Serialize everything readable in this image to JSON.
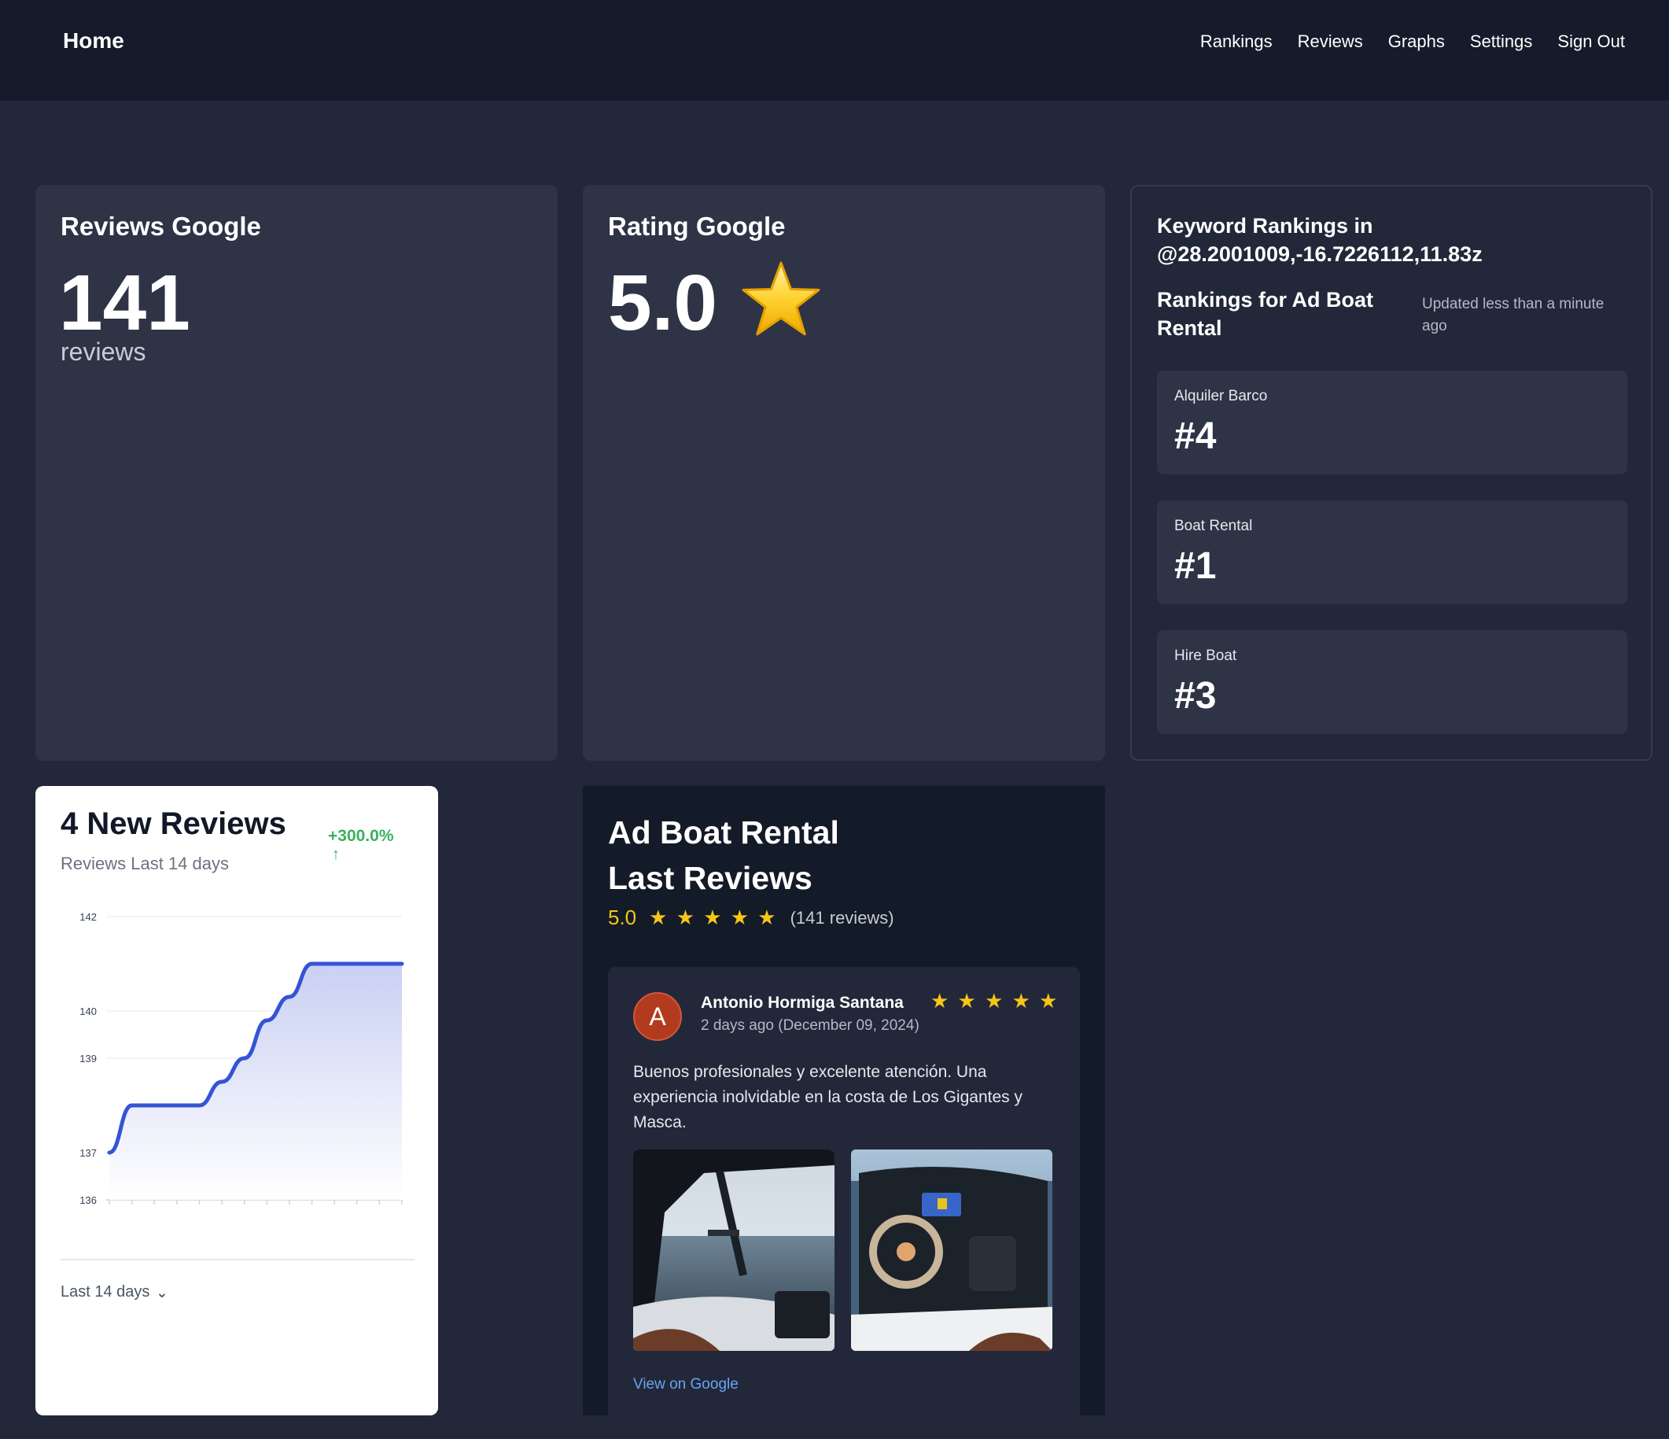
{
  "header": {
    "brand": "Home",
    "nav": [
      "Rankings",
      "Reviews",
      "Graphs",
      "Settings",
      "Sign Out"
    ]
  },
  "reviews_card": {
    "title": "Reviews Google",
    "count": "141",
    "unit": "reviews"
  },
  "rating_card": {
    "title": "Rating Google",
    "value": "5.0",
    "star_icon": "⭐"
  },
  "keywords_card": {
    "title": "Keyword Rankings in @28.2001009,-16.7226112,11.83z",
    "subtitle": "Rankings for Ad Boat Rental",
    "updated": "Updated less than a minute ago",
    "items": [
      {
        "keyword": "Alquiler Barco",
        "rank": "#4"
      },
      {
        "keyword": "Boat Rental",
        "rank": "#1"
      },
      {
        "keyword": "Hire Boat",
        "rank": "#3"
      }
    ]
  },
  "new_reviews_card": {
    "title": "4 New Reviews",
    "subtitle": "Reviews Last 14 days",
    "change": "+300.0%",
    "change_arrow": "↑",
    "range_selector": "Last 14 days",
    "chevron": "⌄"
  },
  "chart_data": {
    "type": "area",
    "title": "",
    "xlabel": "",
    "ylabel": "",
    "y_ticks": [
      "142",
      "140",
      "139",
      "137",
      "136"
    ],
    "ylim": [
      136,
      142
    ],
    "x": [
      0,
      1,
      2,
      3,
      4,
      5,
      6,
      7,
      8,
      9,
      10,
      11,
      12,
      13
    ],
    "values": [
      137,
      138,
      138,
      138,
      138,
      138.5,
      139,
      139.8,
      140.3,
      141,
      141,
      141,
      141,
      141
    ],
    "colors": {
      "line": "#3553d6",
      "fill_top": "#c9d0f3",
      "fill_bottom": "#ffffff"
    }
  },
  "last_reviews_card": {
    "title_line1": "Ad Boat Rental",
    "title_line2": "Last Reviews",
    "rating": "5.0",
    "stars": "★ ★ ★ ★ ★",
    "count": "(141 reviews)",
    "review": {
      "avatar_letter": "A",
      "author": "Antonio Hormiga Santana",
      "date": "2 days ago (December 09, 2024)",
      "stars": "★ ★ ★ ★ ★",
      "text": "Buenos profesionales y excelente atención. Una experiencia inolvidable en la costa de Los Gigantes y Masca.",
      "link": "View on Google"
    }
  },
  "colors": {
    "page_bg": "#222839",
    "header_bg": "#151b2a",
    "card_bg": "#2e3446",
    "accent_green": "#3cb15a",
    "star_yellow": "#f5c518",
    "link_blue": "#6aa2f2",
    "avatar_bg": "#b23a1e"
  }
}
